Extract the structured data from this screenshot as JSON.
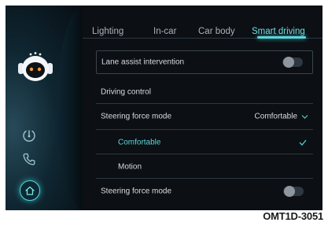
{
  "tabs": [
    {
      "label": "Lighting"
    },
    {
      "label": "In-car"
    },
    {
      "label": "Car body"
    },
    {
      "label": "Smart driving"
    }
  ],
  "active_tab": "Smart driving",
  "lane_assist": {
    "label": "Lane assist intervention",
    "toggle_on": false
  },
  "section_title": "Driving control",
  "steering_force": {
    "label": "Steering force mode",
    "value": "Comfortable"
  },
  "options": [
    {
      "label": "Comfortable",
      "selected": true
    },
    {
      "label": "Motion",
      "selected": false
    }
  ],
  "steering_force_2": {
    "label": "Steering force mode",
    "toggle_on": false
  },
  "rail_icons": [
    "avatar-icon",
    "speedometer-icon",
    "phone-icon",
    "home-icon"
  ],
  "colors": {
    "accent": "#5fd3d8",
    "background": "#0c0f13",
    "text": "#d7dde2"
  },
  "caption": "OMT1D-3051"
}
